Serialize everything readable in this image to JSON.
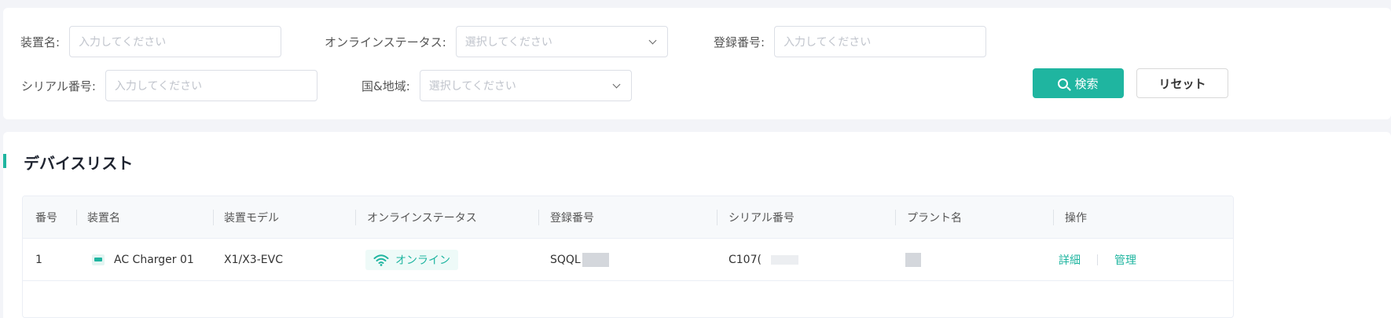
{
  "filters": {
    "device_name": {
      "label": "装置名:",
      "placeholder": "入力してください"
    },
    "online_status": {
      "label": "オンラインステータス:",
      "placeholder": "選択してください"
    },
    "registration_no": {
      "label": "登録番号:",
      "placeholder": "入力してください"
    },
    "serial_no": {
      "label": "シリアル番号:",
      "placeholder": "入力してください"
    },
    "country_region": {
      "label": "国&地域:",
      "placeholder": "選択してください"
    },
    "search_label": "検索",
    "reset_label": "リセット"
  },
  "device_list": {
    "title": "デバイスリスト",
    "columns": [
      "番号",
      "装置名",
      "装置モデル",
      "オンラインステータス",
      "登録番号",
      "シリアル番号",
      "プラント名",
      "操作"
    ],
    "rows": [
      {
        "no": "1",
        "device_name": "AC Charger 01",
        "model": "X1/X3-EVC",
        "status": "オンライン",
        "registration_prefix": "SQQL",
        "serial_prefix": "C107(",
        "actions": {
          "detail": "詳細",
          "manage": "管理"
        }
      }
    ]
  },
  "colors": {
    "accent": "#1fb5a0",
    "background": "#f3f4f8"
  },
  "icons": {
    "search": "search-icon",
    "device": "charger-device-icon",
    "status": "wifi-icon",
    "dropdown": "chevron-down-icon"
  }
}
